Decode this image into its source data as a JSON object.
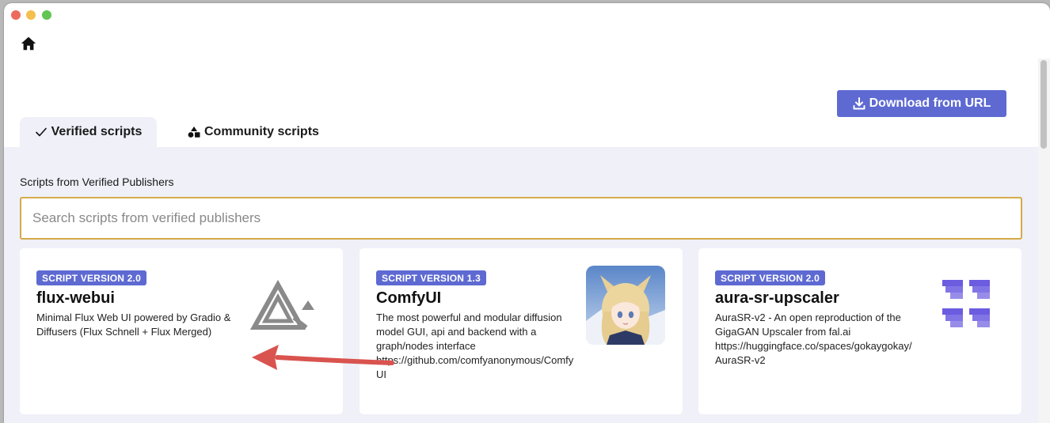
{
  "tabs": [
    {
      "label": "Verified scripts",
      "icon": "checkmark-icon",
      "active": true
    },
    {
      "label": "Community scripts",
      "icon": "shapes-icon",
      "active": false
    }
  ],
  "toolbar": {
    "download_label": "Download from URL",
    "download_icon": "download-icon"
  },
  "main": {
    "section_title": "Scripts from Verified Publishers",
    "search_placeholder": "Search scripts from verified publishers"
  },
  "cards": [
    {
      "badge": "SCRIPT VERSION 2.0",
      "title": "flux-webui",
      "description": "Minimal Flux Web UI powered by Gradio & Diffusers (Flux Schnell + Flux Merged)",
      "logo": "triangle-logo-icon"
    },
    {
      "badge": "SCRIPT VERSION 1.3",
      "title": "ComfyUI",
      "description": "The most powerful and modular diffusion model GUI, api and backend with a graph/nodes interface https://github.com/comfyanonymous/ComfyUI",
      "logo": "anime-character-avatar"
    },
    {
      "badge": "SCRIPT VERSION 2.0",
      "title": "aura-sr-upscaler",
      "description": "AuraSR-v2 - An open reproduction of the GigaGAN Upscaler from fal.ai https://huggingface.co/spaces/gokaygokay/AuraSR-v2",
      "logo": "pixel-blocks-logo-icon"
    }
  ],
  "colors": {
    "accent": "#5e6ad2",
    "search_border": "#d4aa4a",
    "content_bg": "#eff0f8",
    "annotation_arrow": "#d9534f"
  }
}
